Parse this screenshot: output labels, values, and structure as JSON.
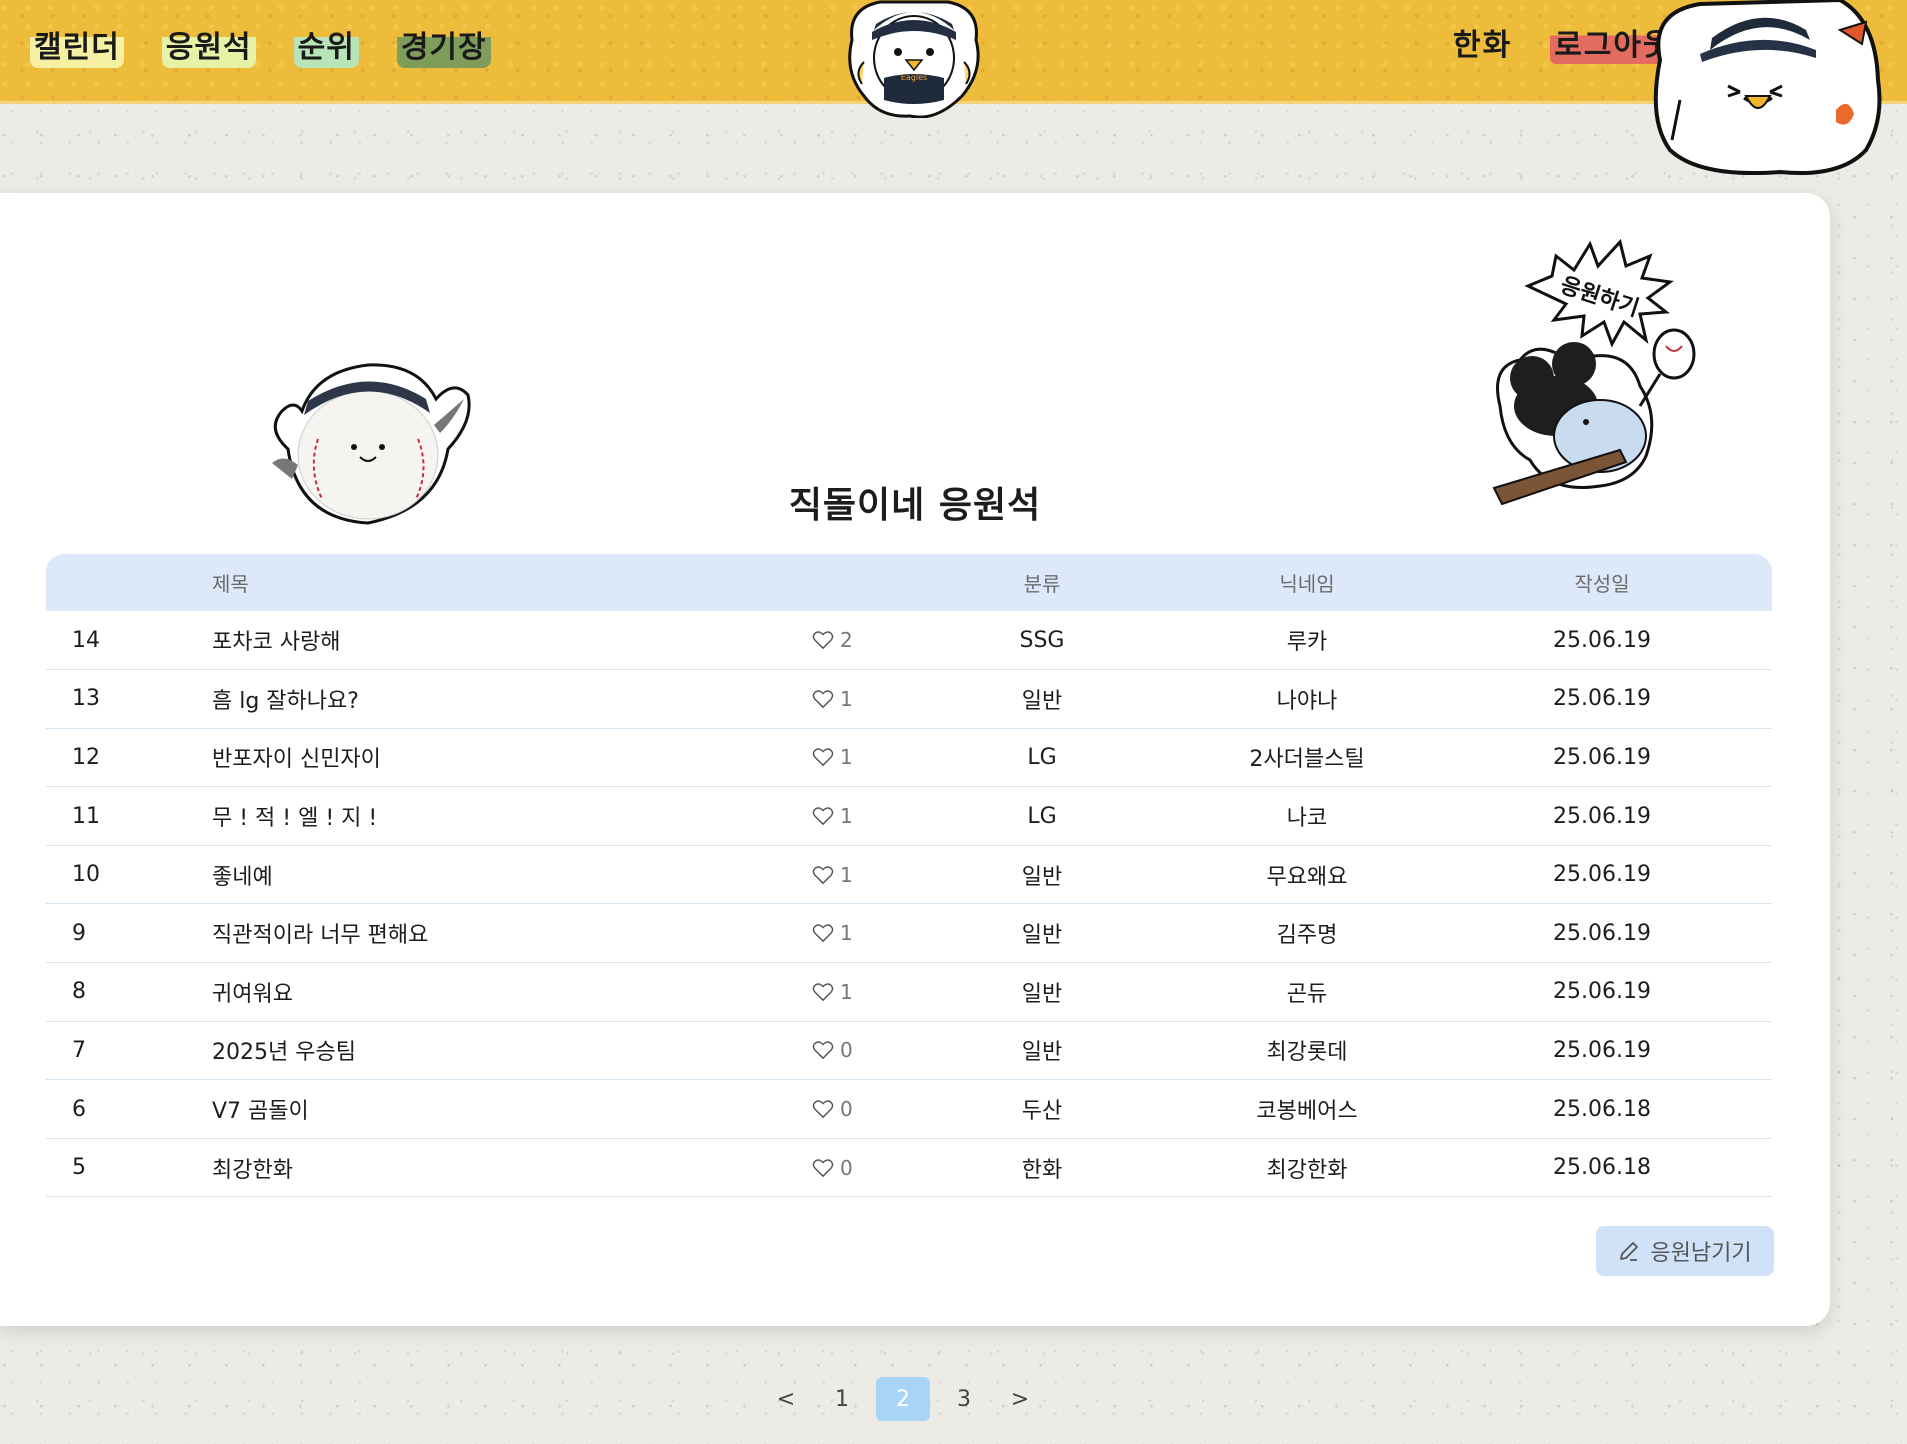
{
  "nav": {
    "calendar": "캘린더",
    "cheer": "응원석",
    "rank": "순위",
    "stadium": "경기장",
    "team": "한화",
    "logout": "로그아웃"
  },
  "sticker_text": "응원하기",
  "board": {
    "title": "직돌이네 응원석",
    "columns": {
      "num": "",
      "title": "제목",
      "likes": "",
      "category": "분류",
      "nickname": "닉네임",
      "date": "작성일"
    },
    "rows": [
      {
        "num": "14",
        "title": "포차코 사랑해",
        "likes": "2",
        "category": "SSG",
        "nickname": "루카",
        "date": "25.06.19"
      },
      {
        "num": "13",
        "title": "흠 lg 잘하나요?",
        "likes": "1",
        "category": "일반",
        "nickname": "나야나",
        "date": "25.06.19"
      },
      {
        "num": "12",
        "title": "반포자이 신민자이",
        "likes": "1",
        "category": "LG",
        "nickname": "2사더블스틸",
        "date": "25.06.19"
      },
      {
        "num": "11",
        "title": "무 ! 적 ! 엘 ! 지 !",
        "likes": "1",
        "category": "LG",
        "nickname": "나코",
        "date": "25.06.19"
      },
      {
        "num": "10",
        "title": "좋네예",
        "likes": "1",
        "category": "일반",
        "nickname": "무요왜요",
        "date": "25.06.19"
      },
      {
        "num": "9",
        "title": "직관적이라 너무 편해요",
        "likes": "1",
        "category": "일반",
        "nickname": "김주명",
        "date": "25.06.19"
      },
      {
        "num": "8",
        "title": "귀여워요",
        "likes": "1",
        "category": "일반",
        "nickname": "곤듀",
        "date": "25.06.19"
      },
      {
        "num": "7",
        "title": "2025년 우승팀",
        "likes": "0",
        "category": "일반",
        "nickname": "최강롯데",
        "date": "25.06.19"
      },
      {
        "num": "6",
        "title": "V7 곰돌이",
        "likes": "0",
        "category": "두산",
        "nickname": "코봉베어스",
        "date": "25.06.18"
      },
      {
        "num": "5",
        "title": "최강한화",
        "likes": "0",
        "category": "한화",
        "nickname": "최강한화",
        "date": "25.06.18"
      }
    ],
    "write_button": "응원남기기"
  },
  "pagination": {
    "prev": "<",
    "next": ">",
    "pages": [
      "1",
      "2",
      "3"
    ],
    "current": "2"
  },
  "colors": {
    "header": "#edbc3a",
    "table_header": "#dde8f9",
    "active_page": "#a9d4f6",
    "logout_highlight": "#e36b5f"
  }
}
